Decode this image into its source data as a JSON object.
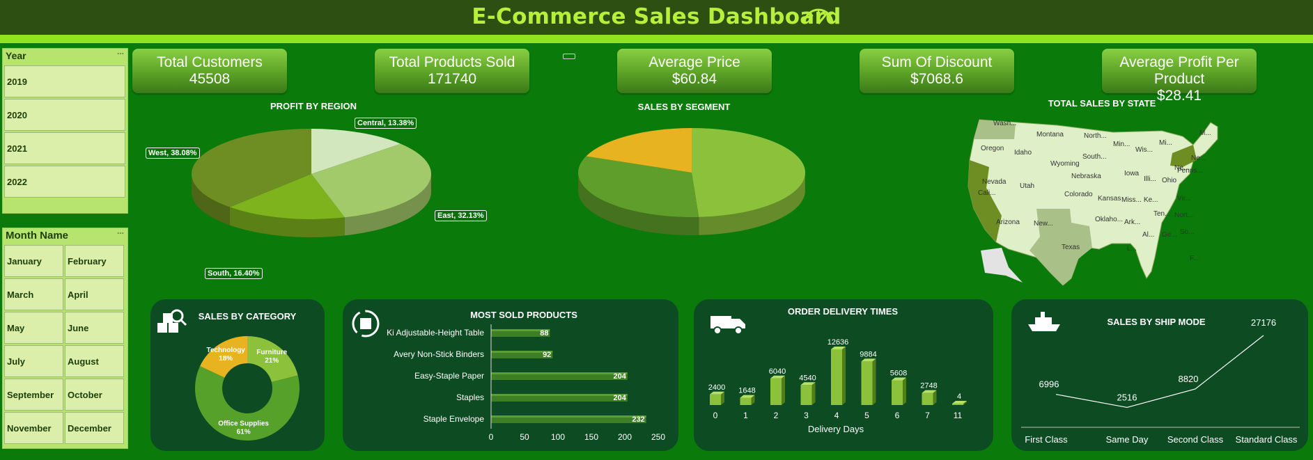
{
  "header": {
    "title": "E-Commerce Sales Dashboard",
    "icon": "speedometer-icon"
  },
  "year_slicer": {
    "label": "Year",
    "items": [
      "2019",
      "2020",
      "2021",
      "2022"
    ]
  },
  "month_slicer": {
    "label": "Month Name",
    "items": [
      "January",
      "February",
      "March",
      "April",
      "May",
      "June",
      "July",
      "August",
      "September",
      "October",
      "November",
      "December"
    ]
  },
  "kpis": [
    {
      "label": "Total Customers",
      "value": "45508"
    },
    {
      "label": "Total Products Sold",
      "value": "171740"
    },
    {
      "label": "Average Price",
      "value": "$60.84"
    },
    {
      "label": "Sum Of Discount",
      "value": "$7068.6"
    },
    {
      "label": "Average Profit Per Product",
      "value": "$28.41"
    }
  ],
  "profit_by_region": {
    "title": "PROFIT BY REGION",
    "labels": [
      "Central, 13.38%",
      "West, 38.08%",
      "East, 32.13%",
      "South, 16.40%"
    ]
  },
  "sales_by_segment": {
    "title": "SALES BY SEGMENT"
  },
  "sales_by_state": {
    "title": "TOTAL SALES BY STATE",
    "states": [
      "Wash...",
      "Montana",
      "North...",
      "Oregon",
      "Idaho",
      "South...",
      "Wyoming",
      "Min...",
      "Wis...",
      "Mi...",
      "Ne...",
      "Penns...",
      "Nebraska",
      "Iowa",
      "Illi...",
      "Ohio",
      "Nevada",
      "Utah",
      "Colorado",
      "Kansas",
      "Miss...",
      "Ke...",
      "Vir...",
      "Cali...",
      "Ne...",
      "Oklaho...",
      "Ark...",
      "Ten...",
      "Nort...",
      "Arizona",
      "New...",
      "Al...",
      "Ge...",
      "So...",
      "Texas",
      "L...",
      "M...",
      "F..."
    ]
  },
  "chart_data": [
    {
      "type": "pie",
      "title": "PROFIT BY REGION",
      "categories": [
        "Central",
        "East",
        "South",
        "West"
      ],
      "values": [
        13.38,
        32.13,
        16.4,
        38.08
      ],
      "unit": "%",
      "colors": [
        "#d3e7bf",
        "#a2c96a",
        "#7fb31e",
        "#6e8d22"
      ]
    },
    {
      "type": "pie",
      "title": "SALES BY SEGMENT",
      "values": [
        49,
        32,
        19
      ],
      "colors": [
        "#8cc13b",
        "#5f9e2a",
        "#e8b320"
      ]
    },
    {
      "type": "pie",
      "title": "SALES BY CATEGORY",
      "categories": [
        "Furniture",
        "Office Supplies",
        "Technology"
      ],
      "values": [
        21,
        61,
        18
      ],
      "unit": "%",
      "labels": [
        "Furniture\n21%",
        "Office Supplies\n61%",
        "Technology\n18%"
      ],
      "colors": [
        "#8cc13b",
        "#56a12a",
        "#e8b320"
      ]
    },
    {
      "type": "bar",
      "title": "MOST SOLD PRODUCTS",
      "categories": [
        "Ki Adjustable-Height Table",
        "Avery Non-Stick Binders",
        "Easy-Staple Paper",
        "Staples",
        "Staple Envelope"
      ],
      "values": [
        88,
        92,
        204,
        204,
        232
      ],
      "xlim": [
        0,
        250
      ],
      "xticks": [
        "0",
        "50",
        "100",
        "150",
        "200",
        "250"
      ]
    },
    {
      "type": "bar",
      "title": "ORDER DELIVERY TIMES",
      "categories": [
        "0",
        "1",
        "2",
        "3",
        "4",
        "5",
        "6",
        "7",
        "11"
      ],
      "values": [
        2400,
        1648,
        6040,
        4540,
        12636,
        9884,
        5608,
        2748,
        4
      ],
      "xlabel": "Delivery Days"
    },
    {
      "type": "line",
      "title": "SALES BY SHIP MODE",
      "categories": [
        "First Class",
        "Same Day",
        "Second Class",
        "Standard Class"
      ],
      "values": [
        6996,
        2516,
        8820,
        27176
      ]
    }
  ],
  "panels": {
    "category_icon": "search-boxes-icon",
    "products_icon": "box-recycle-icon",
    "delivery_icon": "delivery-truck-icon",
    "ship_icon": "ship-icon"
  },
  "colors": {
    "background": "#0a7a0a",
    "header": "#2d4f12",
    "accent": "#8fe31f",
    "title_text": "#b7f03a",
    "panel": "#0d4c23",
    "slicer": "#b7e36f",
    "bar": "#8cc13b"
  }
}
